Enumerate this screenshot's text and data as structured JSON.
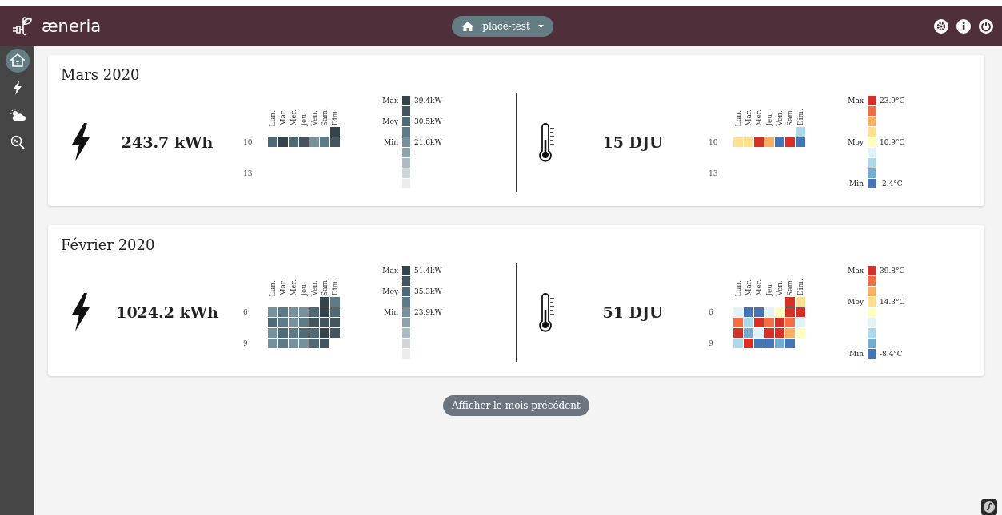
{
  "header": {
    "logo": "æneria",
    "place_selector": "place-test"
  },
  "sidebar": {
    "items": [
      {
        "kind": "home",
        "selected": true
      },
      {
        "kind": "bolt",
        "selected": false
      },
      {
        "kind": "weather",
        "selected": false
      },
      {
        "kind": "analysis",
        "selected": false
      }
    ]
  },
  "months": [
    {
      "title": "Mars 2020",
      "energy": {
        "value": "243.7 kWh",
        "heatmap": {
          "days": [
            "Lun.",
            "Mar.",
            "Mer.",
            "Jeu.",
            "Ven.",
            "Sam.",
            "Dim."
          ],
          "rows": [
            {
              "label": "",
              "cells": [
                null,
                null,
                null,
                null,
                null,
                null,
                {
                  "color": "#34444d"
                }
              ]
            },
            {
              "label": "10",
              "cells": [
                {
                  "color": "#506a75"
                },
                {
                  "color": "#34444d"
                },
                {
                  "color": "#506a75"
                },
                {
                  "color": "#44555f"
                },
                {
                  "color": "#76909c"
                },
                {
                  "color": "#5c7a88"
                },
                {
                  "color": "#44555f"
                }
              ]
            },
            {
              "label": "",
              "cells": []
            },
            {
              "label": "",
              "cells": []
            },
            {
              "label": "13",
              "cells": []
            }
          ]
        },
        "legend": [
          {
            "label": "Max",
            "value": "39.4kW",
            "color": "#34444d"
          },
          {
            "color": "#44555f"
          },
          {
            "label": "Moy",
            "value": "30.5kW",
            "color": "#506a75"
          },
          {
            "color": "#5c7a88"
          },
          {
            "label": "Min",
            "value": "21.6kW",
            "color": "#76909c"
          },
          {
            "color": "#8fa3ad"
          },
          {
            "color": "#adbcc4"
          },
          {
            "color": "#ccd6db"
          },
          {
            "color": "#e9edf0"
          }
        ]
      },
      "weather": {
        "value": "15 DJU",
        "heatmap": {
          "days": [
            "Lun.",
            "Mar.",
            "Mer.",
            "Jeu.",
            "Ven.",
            "Sam.",
            "Dim."
          ],
          "rows": [
            {
              "label": "",
              "cells": [
                null,
                null,
                null,
                null,
                null,
                null,
                {
                  "color": "#abd9e9"
                }
              ]
            },
            {
              "label": "10",
              "cells": [
                {
                  "color": "#fee090"
                },
                {
                  "color": "#fee090"
                },
                {
                  "color": "#d73027"
                },
                {
                  "color": "#fdae61"
                },
                {
                  "color": "#4575b4"
                },
                {
                  "color": "#d73027"
                },
                {
                  "color": "#4575b4"
                }
              ]
            },
            {
              "label": "",
              "cells": []
            },
            {
              "label": "",
              "cells": []
            },
            {
              "label": "13",
              "cells": []
            }
          ]
        },
        "legend": [
          {
            "label": "Max",
            "value": "23.9°C",
            "color": "#d73027"
          },
          {
            "color": "#f46d43"
          },
          {
            "color": "#fdae61"
          },
          {
            "color": "#fee090"
          },
          {
            "label": "Moy",
            "value": "10.9°C",
            "color": "#ffffbf"
          },
          {
            "color": "#e0f3f8"
          },
          {
            "color": "#abd9e9"
          },
          {
            "color": "#74add1"
          },
          {
            "label": "Min",
            "value": "-2.4°C",
            "color": "#4575b4"
          }
        ]
      }
    },
    {
      "title": "Février 2020",
      "energy": {
        "value": "1024.2 kWh",
        "heatmap": {
          "days": [
            "Lun.",
            "Mar.",
            "Mer.",
            "Jeu.",
            "Ven.",
            "Sam.",
            "Dim."
          ],
          "rows": [
            {
              "label": "",
              "cells": [
                null,
                null,
                null,
                null,
                null,
                {
                  "color": "#34444d"
                },
                {
                  "color": "#5c7a88"
                }
              ]
            },
            {
              "label": "6",
              "cells": [
                {
                  "color": "#76909c"
                },
                {
                  "color": "#5c7a88"
                },
                {
                  "color": "#76909c"
                },
                {
                  "color": "#76909c"
                },
                {
                  "color": "#506a75"
                },
                {
                  "color": "#34444d"
                },
                {
                  "color": "#506a75"
                }
              ]
            },
            {
              "label": "",
              "cells": [
                {
                  "color": "#506a75"
                },
                {
                  "color": "#5c7a88"
                },
                {
                  "color": "#76909c"
                },
                {
                  "color": "#5c7a88"
                },
                {
                  "color": "#44555f"
                },
                {
                  "color": "#44555f"
                },
                {
                  "color": "#44555f"
                }
              ]
            },
            {
              "label": "",
              "cells": [
                {
                  "color": "#76909c"
                },
                {
                  "color": "#506a75"
                },
                {
                  "color": "#5c7a88"
                },
                {
                  "color": "#506a75"
                },
                {
                  "color": "#506a75"
                },
                {
                  "color": "#34444d"
                },
                {
                  "color": "#44555f"
                }
              ]
            },
            {
              "label": "9",
              "cells": [
                {
                  "color": "#76909c"
                },
                {
                  "color": "#5c7a88"
                },
                {
                  "color": "#76909c"
                },
                {
                  "color": "#76909c"
                },
                {
                  "color": "#506a75"
                },
                {
                  "color": "#44555f"
                },
                null
              ]
            }
          ]
        },
        "legend": [
          {
            "label": "Max",
            "value": "51.4kW",
            "color": "#34444d"
          },
          {
            "color": "#44555f"
          },
          {
            "label": "Moy",
            "value": "35.3kW",
            "color": "#506a75"
          },
          {
            "color": "#5c7a88"
          },
          {
            "label": "Min",
            "value": "23.9kW",
            "color": "#76909c"
          },
          {
            "color": "#8fa3ad"
          },
          {
            "color": "#adbcc4"
          },
          {
            "color": "#ccd6db"
          },
          {
            "color": "#e9edf0"
          }
        ]
      },
      "weather": {
        "value": "51 DJU",
        "heatmap": {
          "days": [
            "Lun.",
            "Mar.",
            "Mer.",
            "Jeu.",
            "Ven.",
            "Sam.",
            "Dim."
          ],
          "rows": [
            {
              "label": "",
              "cells": [
                null,
                null,
                null,
                null,
                null,
                {
                  "color": "#d73027"
                },
                {
                  "color": "#fee090"
                }
              ]
            },
            {
              "label": "6",
              "cells": [
                {
                  "color": "#e0f3f8"
                },
                {
                  "color": "#4575b4"
                },
                {
                  "color": "#4575b4"
                },
                {
                  "color": "#e0f3f8"
                },
                {
                  "color": "#ffffbf"
                },
                {
                  "color": "#d73027"
                },
                {
                  "color": "#d73027"
                }
              ]
            },
            {
              "label": "",
              "cells": [
                {
                  "color": "#f46d43"
                },
                {
                  "color": "#abd9e9"
                },
                {
                  "color": "#d73027"
                },
                {
                  "color": "#f46d43"
                },
                {
                  "color": "#d73027"
                },
                {
                  "color": "#f46d43"
                },
                {
                  "color": "#e0f3f8"
                }
              ]
            },
            {
              "label": "",
              "cells": [
                {
                  "color": "#d73027"
                },
                {
                  "color": "#74add1"
                },
                {
                  "color": "#e0f3f8"
                },
                {
                  "color": "#d73027"
                },
                {
                  "color": "#d73027"
                },
                {
                  "color": "#fdae61"
                },
                {
                  "color": "#ffffbf"
                }
              ]
            },
            {
              "label": "9",
              "cells": [
                {
                  "color": "#abd9e9"
                },
                {
                  "color": "#d73027"
                },
                {
                  "color": "#4575b4"
                },
                {
                  "color": "#4575b4"
                },
                {
                  "color": "#74add1"
                },
                {
                  "color": "#4575b4"
                },
                null
              ]
            }
          ]
        },
        "legend": [
          {
            "label": "Max",
            "value": "39.8°C",
            "color": "#d73027"
          },
          {
            "color": "#f46d43"
          },
          {
            "color": "#fdae61"
          },
          {
            "label": "Moy",
            "value": "14.3°C",
            "color": "#fee090"
          },
          {
            "color": "#ffffbf"
          },
          {
            "color": "#e0f3f8"
          },
          {
            "color": "#abd9e9"
          },
          {
            "color": "#74add1"
          },
          {
            "label": "Min",
            "value": "-8.4°C",
            "color": "#4575b4"
          }
        ]
      }
    }
  ],
  "more_button": "Afficher le mois précédent"
}
